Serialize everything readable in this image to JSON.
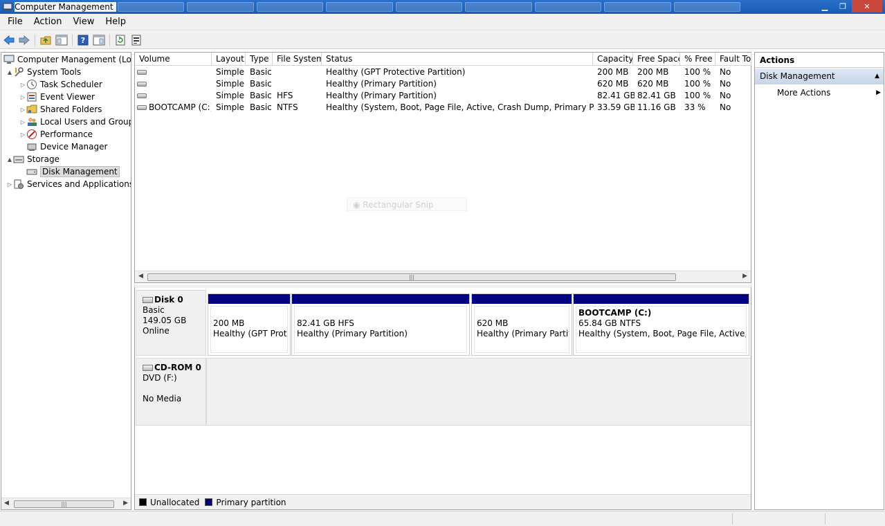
{
  "window": {
    "title": "Computer Management"
  },
  "menu": [
    "File",
    "Action",
    "View",
    "Help"
  ],
  "tree": [
    {
      "label": "Computer Management (Local",
      "icon": "computer-icon",
      "expander": "",
      "level": 0
    },
    {
      "label": "System Tools",
      "icon": "tools-icon",
      "expander": "▲",
      "level": 1
    },
    {
      "label": "Task Scheduler",
      "icon": "clock-icon",
      "expander": "▷",
      "level": 2
    },
    {
      "label": "Event Viewer",
      "icon": "event-viewer-icon",
      "expander": "▷",
      "level": 2
    },
    {
      "label": "Shared Folders",
      "icon": "shared-folders-icon",
      "expander": "▷",
      "level": 2
    },
    {
      "label": "Local Users and Groups",
      "icon": "users-icon",
      "expander": "▷",
      "level": 2
    },
    {
      "label": "Performance",
      "icon": "performance-icon",
      "expander": "▷",
      "level": 2
    },
    {
      "label": "Device Manager",
      "icon": "device-manager-icon",
      "expander": "",
      "level": 2
    },
    {
      "label": "Storage",
      "icon": "storage-icon",
      "expander": "▲",
      "level": 1
    },
    {
      "label": "Disk Management",
      "icon": "disk-management-icon",
      "expander": "",
      "level": 2,
      "selected": true
    },
    {
      "label": "Services and Applications",
      "icon": "services-icon",
      "expander": "▷",
      "level": 1
    }
  ],
  "volumes": {
    "columns": [
      "Volume",
      "Layout",
      "Type",
      "File System",
      "Status",
      "Capacity",
      "Free Space",
      "% Free",
      "Fault Tol"
    ],
    "rows": [
      [
        "",
        "Simple",
        "Basic",
        "",
        "Healthy (GPT Protective Partition)",
        "200 MB",
        "200 MB",
        "100 %",
        "No"
      ],
      [
        "",
        "Simple",
        "Basic",
        "",
        "Healthy (Primary Partition)",
        "620 MB",
        "620 MB",
        "100 %",
        "No"
      ],
      [
        "",
        "Simple",
        "Basic",
        "HFS",
        "Healthy (Primary Partition)",
        "82.41 GB",
        "82.41 GB",
        "100 %",
        "No"
      ],
      [
        "BOOTCAMP (C:)",
        "Simple",
        "Basic",
        "NTFS",
        "Healthy (System, Boot, Page File, Active, Crash Dump, Primary Partition)",
        "33.59 GB",
        "11.16 GB",
        "33 %",
        "No"
      ]
    ]
  },
  "snip_overlay": "Rectangular Snip",
  "disks": [
    {
      "name": "Disk 0",
      "lines": [
        "Basic",
        "149.05 GB",
        "Online"
      ],
      "partitions": [
        {
          "name": "",
          "size": "200 MB",
          "status": "Healthy (GPT Protec"
        },
        {
          "name": "",
          "size": "82.41 GB HFS",
          "status": "Healthy (Primary Partition)"
        },
        {
          "name": "",
          "size": "620 MB",
          "status": "Healthy (Primary Partitio"
        },
        {
          "name": "BOOTCAMP  (C:)",
          "size": "65.84 GB NTFS",
          "status": "Healthy (System, Boot, Page File, Active, Crasl"
        }
      ]
    },
    {
      "name": "CD-ROM 0",
      "lines": [
        "DVD (F:)",
        "",
        "No Media"
      ]
    }
  ],
  "legend": [
    {
      "label": "Unallocated",
      "color": "#000000"
    },
    {
      "label": "Primary partition",
      "color": "#000080"
    }
  ],
  "actions": {
    "header": "Actions",
    "section": "Disk Management",
    "items": [
      "More Actions"
    ]
  },
  "colors": {
    "titlebar": "#1a5cb5",
    "partition_bar": "#000080",
    "action_section": "#c7d5e8"
  }
}
